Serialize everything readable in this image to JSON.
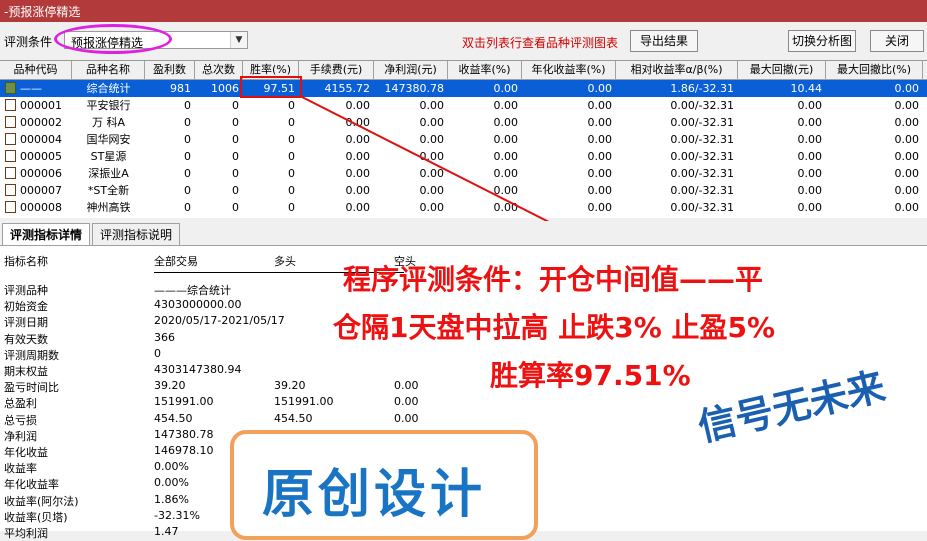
{
  "window": {
    "title": "-预报涨停精选"
  },
  "toolbar": {
    "condition_label": "评测条件",
    "condition_value": "预报涨停精选",
    "hint": "双击列表行查看品种评测图表",
    "export_label": "导出结果",
    "switch_label": "切换分析图",
    "close_label": "关闭"
  },
  "table": {
    "headers": [
      "品种代码",
      "品种名称",
      "盈利数",
      "总次数",
      "胜率(%)",
      "手续费(元)",
      "净利润(元)",
      "收益率(%)",
      "年化收益率(%)",
      "相对收益率α/β(%)",
      "最大回撤(元)",
      "最大回撤比(%)"
    ],
    "rows": [
      [
        "——",
        "综合统计",
        "981",
        "1006",
        "97.51",
        "4155.72",
        "147380.78",
        "0.00",
        "0.00",
        "1.86/-32.31",
        "10.44",
        "0.00"
      ],
      [
        "000001",
        "平安银行",
        "0",
        "0",
        "0",
        "0.00",
        "0.00",
        "0.00",
        "0.00",
        "0.00/-32.31",
        "0.00",
        "0.00"
      ],
      [
        "000002",
        "万 科A",
        "0",
        "0",
        "0",
        "0.00",
        "0.00",
        "0.00",
        "0.00",
        "0.00/-32.31",
        "0.00",
        "0.00"
      ],
      [
        "000004",
        "国华网安",
        "0",
        "0",
        "0",
        "0.00",
        "0.00",
        "0.00",
        "0.00",
        "0.00/-32.31",
        "0.00",
        "0.00"
      ],
      [
        "000005",
        "ST星源",
        "0",
        "0",
        "0",
        "0.00",
        "0.00",
        "0.00",
        "0.00",
        "0.00/-32.31",
        "0.00",
        "0.00"
      ],
      [
        "000006",
        "深振业A",
        "0",
        "0",
        "0",
        "0.00",
        "0.00",
        "0.00",
        "0.00",
        "0.00/-32.31",
        "0.00",
        "0.00"
      ],
      [
        "000007",
        "*ST全新",
        "0",
        "0",
        "0",
        "0.00",
        "0.00",
        "0.00",
        "0.00",
        "0.00/-32.31",
        "0.00",
        "0.00"
      ],
      [
        "000008",
        "神州高铁",
        "0",
        "0",
        "0",
        "0.00",
        "0.00",
        "0.00",
        "0.00",
        "0.00/-32.31",
        "0.00",
        "0.00"
      ]
    ]
  },
  "tabs": {
    "details": "评测指标详情",
    "explain": "评测指标说明"
  },
  "detail": {
    "headers": {
      "name": "指标名称",
      "all": "全部交易",
      "long": "多头",
      "short": "空头"
    },
    "rows": [
      {
        "label": "评测品种",
        "all": "———综合统计",
        "long": "",
        "short": ""
      },
      {
        "label": "初始资金",
        "all": "4303000000.00",
        "long": "",
        "short": ""
      },
      {
        "label": "评测日期",
        "all": "2020/05/17-2021/05/17",
        "long": "",
        "short": ""
      },
      {
        "label": "有效天数",
        "all": "366",
        "long": "",
        "short": ""
      },
      {
        "label": "评测周期数",
        "all": "0",
        "long": "",
        "short": ""
      },
      {
        "label": "期末权益",
        "all": "4303147380.94",
        "long": "",
        "short": ""
      },
      {
        "label": "盈亏时间比",
        "all": "39.20",
        "long": "39.20",
        "short": "0.00"
      },
      {
        "label": "总盈利",
        "all": "151991.00",
        "long": "151991.00",
        "short": "0.00"
      },
      {
        "label": "总亏损",
        "all": "454.50",
        "long": "454.50",
        "short": "0.00"
      },
      {
        "label": "净利润",
        "all": "147380.78",
        "long": "",
        "short": ""
      },
      {
        "label": "年化收益",
        "all": "146978.10",
        "long": "",
        "short": ""
      },
      {
        "label": "收益率",
        "all": "0.00%",
        "long": "",
        "short": ""
      },
      {
        "label": "年化收益率",
        "all": "0.00%",
        "long": "",
        "short": ""
      },
      {
        "label": "收益率(阿尔法)",
        "all": "1.86%",
        "long": "",
        "short": ""
      },
      {
        "label": "收益率(贝塔)",
        "all": "-32.31%",
        "long": "",
        "short": ""
      },
      {
        "label": "平均利润",
        "all": "1.47",
        "long": "",
        "short": ""
      }
    ]
  },
  "annotation": {
    "line1": "程序评测条件：开仓中间值——平",
    "line2": "仓隔1天盘中拉高 止跌3%  止盈5%",
    "line3": "胜算率97.51%"
  },
  "stamp": {
    "text": "原创设计"
  },
  "signature": {
    "text": "信号无未来"
  },
  "colors": {
    "title_bar": "#b33a3a",
    "selected_row": "#0a5fd6",
    "annotation_red": "#ee1111",
    "highlight_magenta": "#e020e0",
    "stamp_blue": "#1a74c4"
  }
}
